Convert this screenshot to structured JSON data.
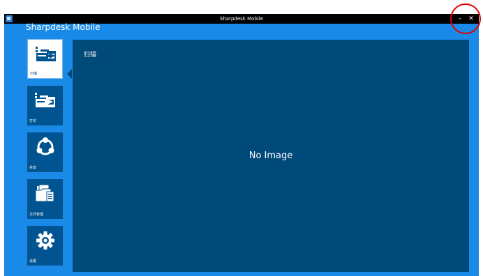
{
  "window": {
    "title": "Sharpdesk Mobile"
  },
  "brand": {
    "name": "Sharpdesk Mobile"
  },
  "titlebar": {
    "minimize_glyph": "–",
    "close_glyph": "✕"
  },
  "nav": {
    "items": [
      {
        "label": "扫描",
        "icon": "scan-icon",
        "active": true
      },
      {
        "label": "打印",
        "icon": "print-icon",
        "active": false
      },
      {
        "label": "共享",
        "icon": "share-icon",
        "active": false
      },
      {
        "label": "文件管理",
        "icon": "file-manage-icon",
        "active": false
      },
      {
        "label": "设置",
        "icon": "gear-icon",
        "active": false
      }
    ]
  },
  "content": {
    "title": "扫描",
    "placeholder": "No Image"
  },
  "colors": {
    "accent": "#1a8ae8",
    "panel": "#004a79",
    "tile": "#005491",
    "annotation": "#e00000"
  }
}
